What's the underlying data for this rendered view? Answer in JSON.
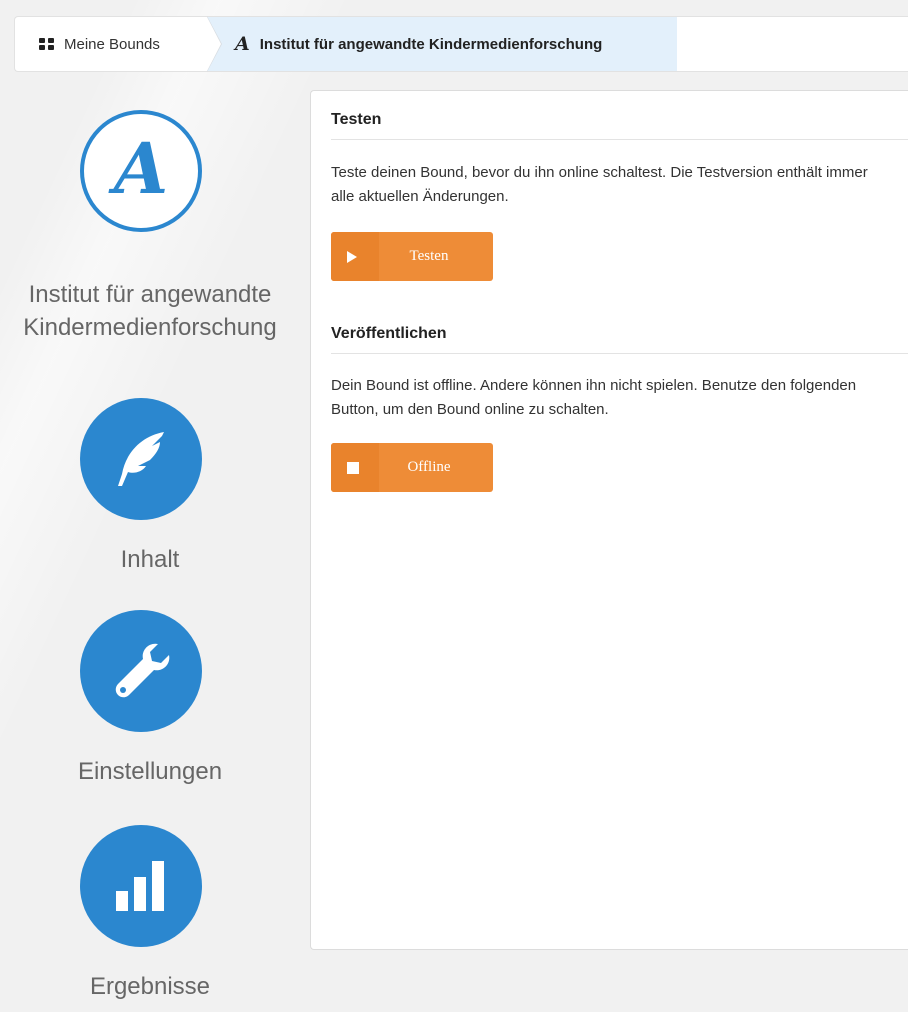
{
  "breadcrumb": {
    "home_label": "Meine Bounds",
    "home_icon": "grid-icon",
    "current_label": "Institut für angewandte Kindermedienforschung",
    "current_icon": "script-a-icon"
  },
  "sidebar": {
    "items": [
      {
        "label": "Institut für angewandte Kindermedienforschung",
        "icon": "script-a-icon",
        "style": "outline"
      },
      {
        "label": "Inhalt",
        "icon": "feather-icon",
        "style": "filled"
      },
      {
        "label": "Einstellungen",
        "icon": "wrench-icon",
        "style": "filled"
      },
      {
        "label": "Ergebnisse",
        "icon": "bar-chart-icon",
        "style": "filled"
      }
    ],
    "brand_letter": "A"
  },
  "main": {
    "test": {
      "title": "Testen",
      "text": "Teste deinen Bound, bevor du ihn online schaltest. Die Testversion enthält immer alle aktuellen Änderungen.",
      "button_label": "Testen"
    },
    "publish": {
      "title": "Veröffentlichen",
      "text": "Dein Bound ist offline. Andere können ihn nicht spielen. Benutze den folgenden Button, um den Bound online zu schalten.",
      "button_label": "Offline"
    }
  },
  "colors": {
    "accent_blue": "#2b87cf",
    "accent_orange": "#ee8c37",
    "breadcrumb_active_bg": "#e3f0fb"
  }
}
